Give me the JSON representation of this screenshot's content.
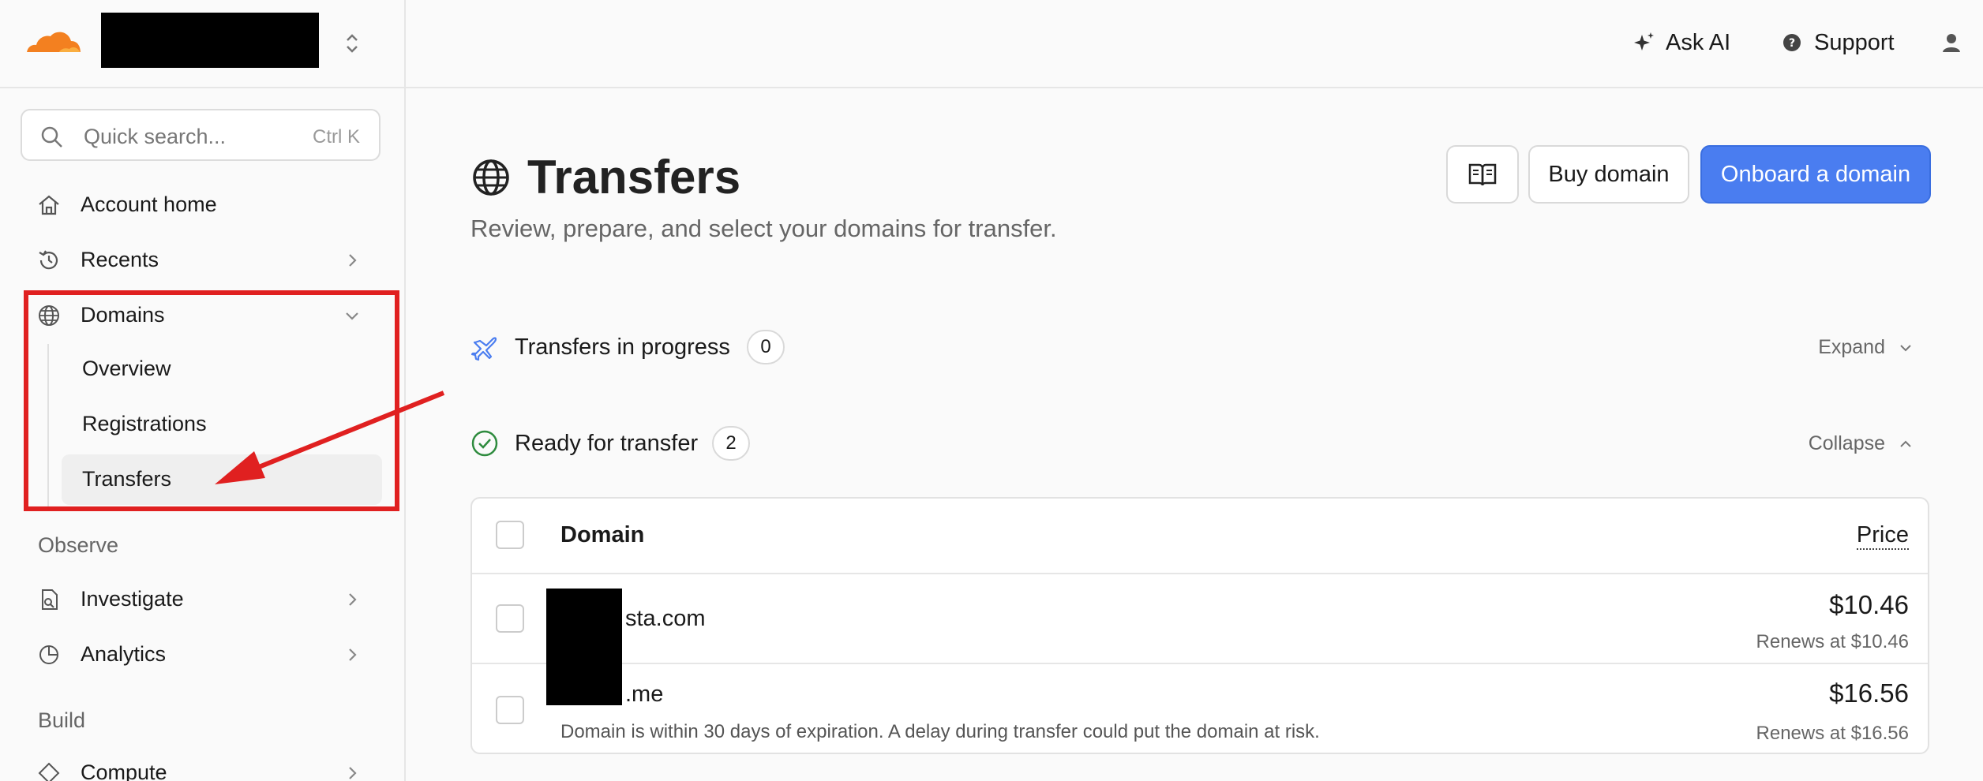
{
  "sidebar": {
    "search": {
      "placeholder": "Quick search...",
      "shortcut": "Ctrl K"
    },
    "items": [
      {
        "label": "Account home",
        "icon": "home-icon"
      },
      {
        "label": "Recents",
        "icon": "history-icon"
      },
      {
        "label": "Domains",
        "icon": "globe-icon"
      }
    ],
    "domains_sub": [
      {
        "label": "Overview"
      },
      {
        "label": "Registrations"
      },
      {
        "label": "Transfers"
      }
    ],
    "observe_title": "Observe",
    "observe_items": [
      {
        "label": "Investigate",
        "icon": "investigate-icon"
      },
      {
        "label": "Analytics",
        "icon": "analytics-icon"
      }
    ],
    "build_title": "Build",
    "build_items": [
      {
        "label": "Compute",
        "icon": "compute-icon"
      }
    ]
  },
  "topbar": {
    "ask_ai": "Ask AI",
    "support": "Support"
  },
  "page": {
    "title": "Transfers",
    "subtitle": "Review, prepare, and select your domains for transfer.",
    "buy_domain": "Buy domain",
    "onboard_domain": "Onboard a domain"
  },
  "sections": {
    "in_progress": {
      "label": "Transfers in progress",
      "count": "0",
      "toggle": "Expand"
    },
    "ready": {
      "label": "Ready for transfer",
      "count": "2",
      "toggle": "Collapse"
    }
  },
  "table": {
    "col_domain": "Domain",
    "col_price": "Price",
    "rows": [
      {
        "domain": "sta.com",
        "price": "$10.46",
        "renews": "Renews at $10.46",
        "warning": ""
      },
      {
        "domain": ".me",
        "price": "$16.56",
        "renews": "Renews at $16.56",
        "warning": "Domain is within 30 days of expiration. A delay during transfer could put the domain at risk."
      }
    ]
  },
  "colors": {
    "brand_orange": "#f38020",
    "primary": "#4a7df0",
    "highlight_red": "#e02020"
  }
}
